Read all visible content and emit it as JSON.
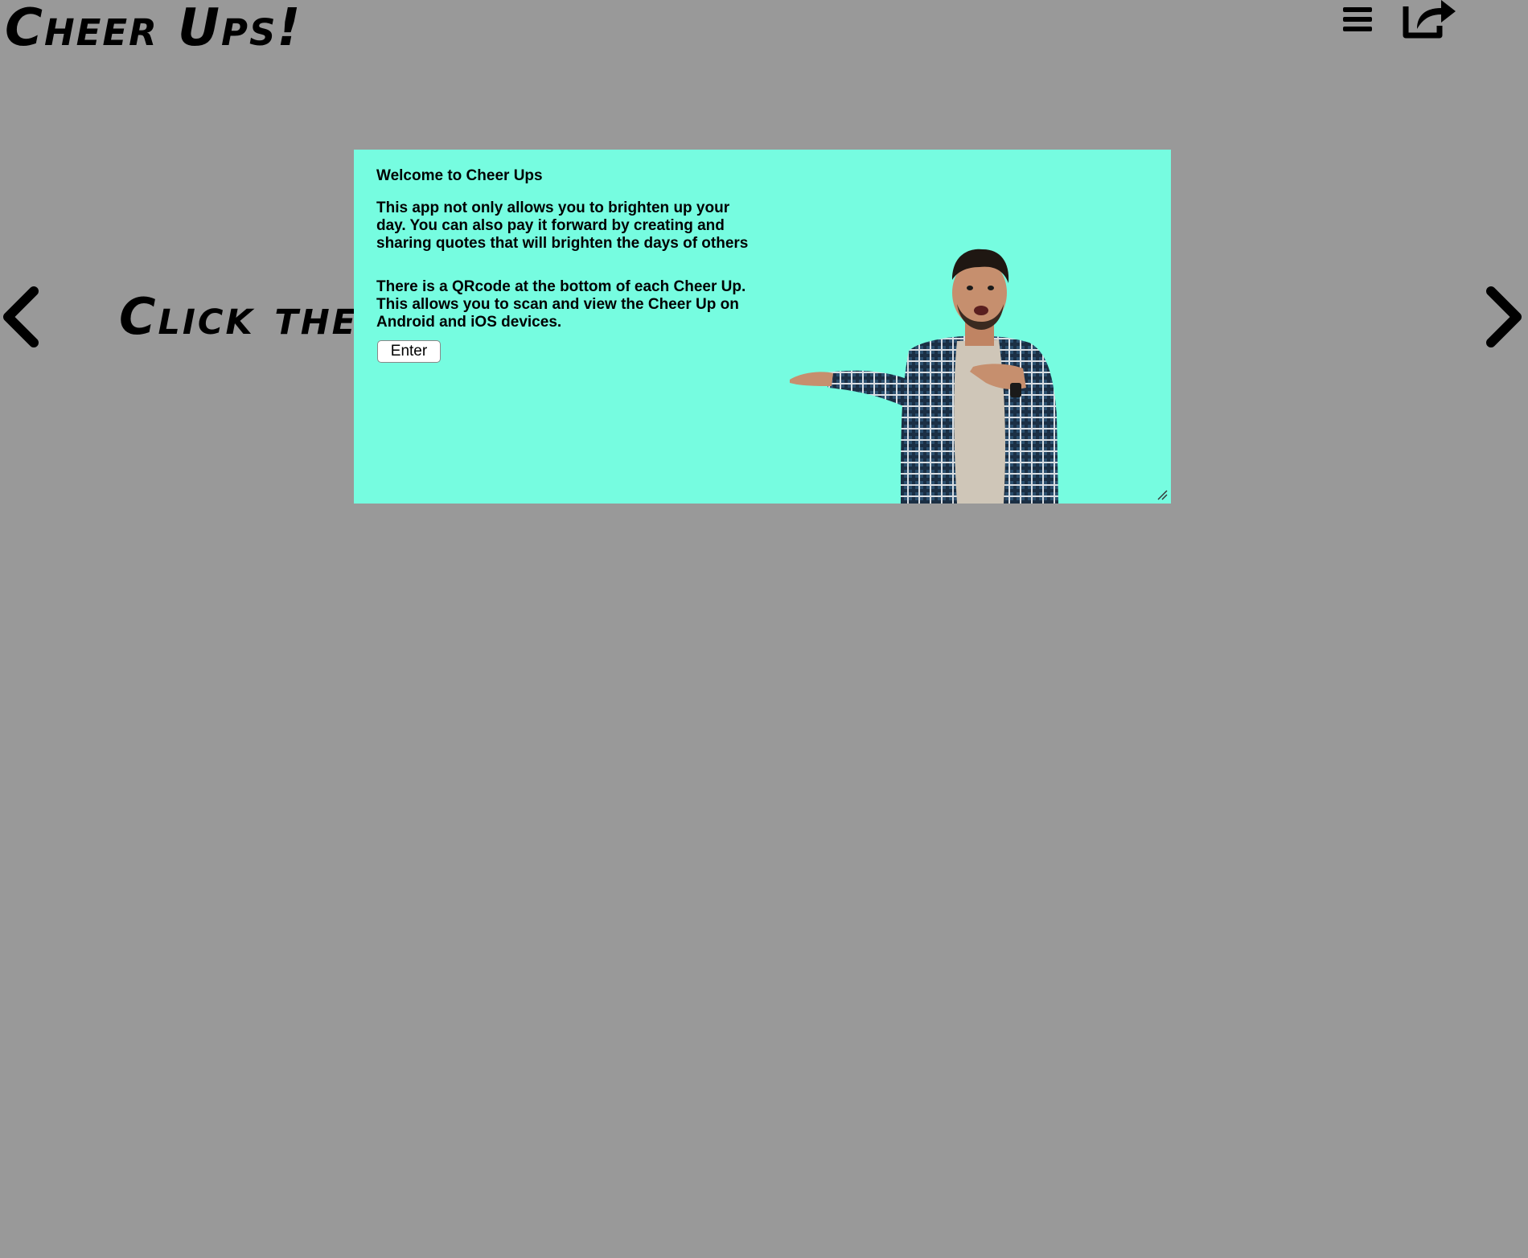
{
  "header": {
    "title": "Cheer Ups!",
    "menu_icon": "hamburger-menu-icon",
    "share_icon": "share-icon"
  },
  "carousel": {
    "instruction": "Click the Arrows to view Cheers",
    "prev_icon": "chevron-left-icon",
    "next_icon": "chevron-right-icon"
  },
  "dialog": {
    "title": "Welcome to Cheer Ups",
    "paragraph_1": "This app not only allows you to brighten up your day. You can also pay it forward by creating and sharing quotes that will brighten the days of others",
    "paragraph_2": "There is a QRcode at the bottom of each Cheer Up. This allows you to scan and view the Cheer Up on Android and iOS devices.",
    "enter_label": "Enter",
    "background_color": "#76fce0"
  },
  "colors": {
    "page_background": "#999999",
    "text": "#000000"
  }
}
